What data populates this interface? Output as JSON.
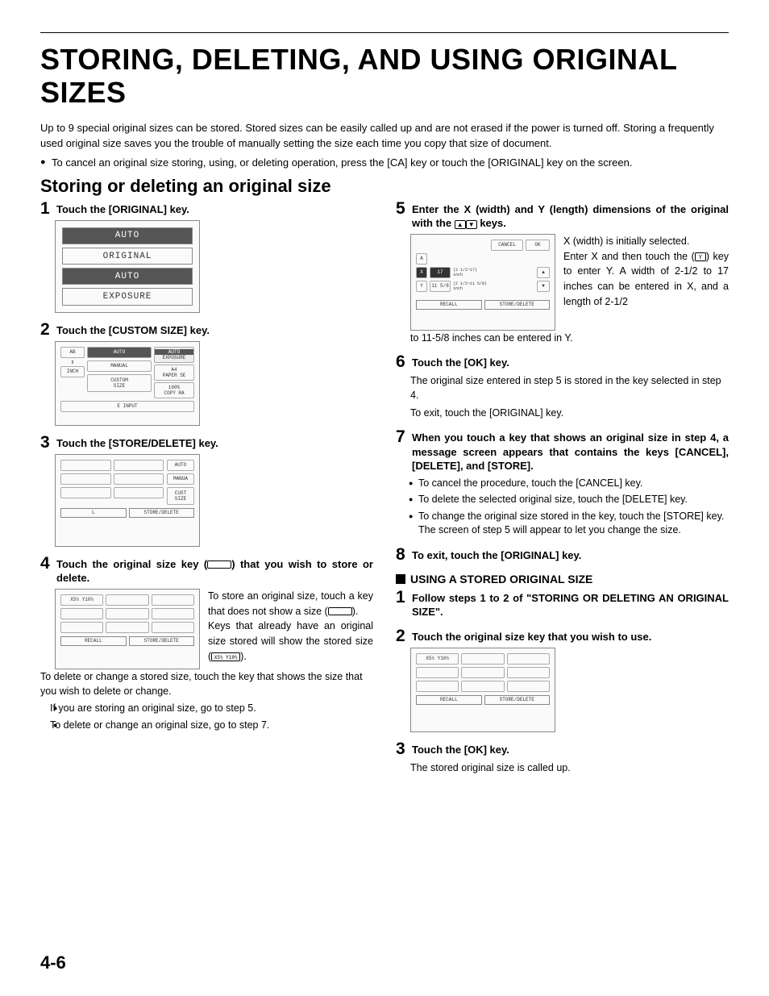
{
  "title": "STORING, DELETING, AND USING ORIGINAL SIZES",
  "intro": "Up to 9 special original sizes can be stored. Stored sizes can be easily called up and are not erased if the power is turned off. Storing a frequently used original size saves you the trouble of manually setting the size each time you copy that size of document.",
  "top_bullet": "To cancel an original size storing, using, or deleting operation, press the [CA] key or touch the [ORIGINAL] key on the screen.",
  "subtitle": "Storing or deleting an original size",
  "steps": {
    "s1": {
      "num": "1",
      "title": "Touch the [ORIGINAL] key."
    },
    "s2": {
      "num": "2",
      "title": "Touch the [CUSTOM SIZE] key."
    },
    "s3": {
      "num": "3",
      "title": "Touch the [STORE/DELETE] key."
    },
    "s4": {
      "num": "4",
      "title_a": "Touch the original size key (",
      "title_b": ") that you wish to store or delete.",
      "side_a": "To store an original size, touch a key that does not show a size (",
      "side_b": ").",
      "side_c": "Keys that already have an original size stored will show the stored size (",
      "side_d": ").",
      "key_label": "X5½ Y10½",
      "body": "To delete or change a stored size, touch the key that shows the size that you wish to delete or change.",
      "b1": "If you are storing an original size, go to step 5.",
      "b2": "To delete or change an original size, go to step 7."
    },
    "s5": {
      "num": "5",
      "title": "Enter the X (width) and Y (length) dimensions of the original with the ",
      "title_b": " keys.",
      "side": "X (width) is initially selected.",
      "side2a": "Enter X and then touch the (",
      "side2b": ") key to enter Y. A width of 2-1/2 to 17 inches can be entered in X, and a length of 2-1/2",
      "tail": "to 11-5/8 inches can be entered in Y."
    },
    "s6": {
      "num": "6",
      "title": "Touch the [OK] key.",
      "body1": "The original size entered in step 5 is stored in the key selected in step 4.",
      "body2": "To exit, touch the [ORIGINAL] key."
    },
    "s7": {
      "num": "7",
      "title": "When you touch a key that shows an original size in step 4, a message screen appears that contains the keys [CANCEL], [DELETE], and [STORE].",
      "b1": "To cancel the procedure, touch the [CANCEL] key.",
      "b2": "To delete the selected original size, touch the [DELETE] key.",
      "b3": "To change the original size stored in the key, touch the [STORE] key. The screen of step 5 will appear to let you change the size."
    },
    "s8": {
      "num": "8",
      "title": "To exit, touch the [ORIGINAL] key."
    }
  },
  "section2": "USING A STORED ORIGINAL SIZE",
  "use": {
    "u1": {
      "num": "1",
      "title": "Follow steps 1 to 2 of \"STORING OR DELETING AN ORIGINAL SIZE\"."
    },
    "u2": {
      "num": "2",
      "title": "Touch the original size key that you wish to use."
    },
    "u3": {
      "num": "3",
      "title": "Touch the [OK] key.",
      "body": "The stored original size is called up."
    }
  },
  "fig1": {
    "auto": "AUTO",
    "original": "ORIGINAL",
    "auto2": "AUTO",
    "exposure": "EXPOSURE"
  },
  "fig2": {
    "ab": "AB",
    "inch": "INCH",
    "auto": "AUTO",
    "manual": "MANUAL",
    "custom": "CUSTOM",
    "size": "SIZE",
    "exposure": "EXPOSURE",
    "a4": "A4",
    "paper": "PAPER SE",
    "ratio": "100%",
    "copy": "COPY RA",
    "input": "E INPUT"
  },
  "fig3": {
    "auto": "AUTO",
    "manual": "MANUA",
    "cust": "CUST",
    "size": "SIZE",
    "store": "STORE/DELETE",
    "l": "L"
  },
  "fig4": {
    "label": "X5½ Y10½",
    "recall": "RECALL",
    "store": "STORE/DELETE"
  },
  "fig5": {
    "cancel": "CANCEL",
    "ok": "OK",
    "a": "A",
    "x": "X",
    "y": "Y",
    "xval": "17",
    "xrange": "(2 1/2~17)",
    "inch": "inch",
    "yval": "11 5/8",
    "yrange": "(2 1/2~11 5/8)",
    "recall": "RECALL",
    "store": "STORE/DELETE"
  },
  "fig6": {
    "label": "X5½ Y10½",
    "recall": "RECALL",
    "store": "STORE/DELETE"
  },
  "page": "4-6"
}
